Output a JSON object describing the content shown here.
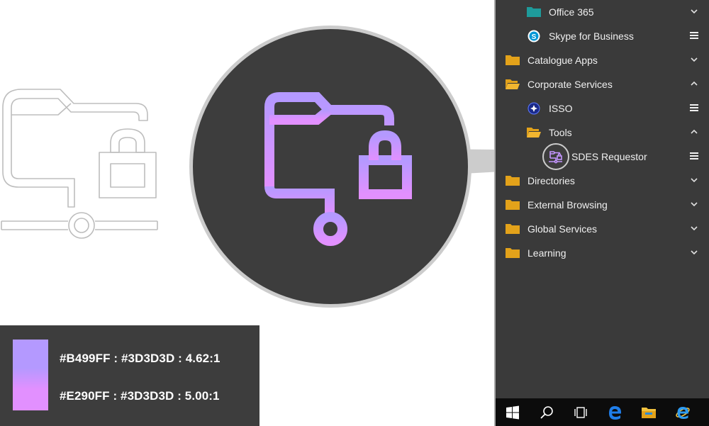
{
  "menu": {
    "items": [
      {
        "label": "Office 365",
        "level": 1,
        "icon": "folder-teal-icon",
        "action": "chevron-down-icon"
      },
      {
        "label": "Skype for Business",
        "level": 1,
        "icon": "skype-icon",
        "action": "hamburger-menu-icon"
      },
      {
        "label": "Catalogue Apps",
        "level": 0,
        "icon": "folder-icon",
        "action": "chevron-down-icon"
      },
      {
        "label": "Corporate Services",
        "level": 0,
        "icon": "folder-open-icon",
        "action": "chevron-up-icon"
      },
      {
        "label": "ISSO",
        "level": 1,
        "icon": "isso-icon",
        "action": "hamburger-menu-icon"
      },
      {
        "label": "Tools",
        "level": 1,
        "icon": "folder-open-icon",
        "action": "chevron-up-icon"
      },
      {
        "label": "SDES Requestor",
        "level": 2,
        "icon": "secure-network-folder-icon",
        "action": "hamburger-menu-icon"
      },
      {
        "label": "Directories",
        "level": 0,
        "icon": "folder-icon",
        "action": "chevron-down-icon"
      },
      {
        "label": "External Browsing",
        "level": 0,
        "icon": "folder-icon",
        "action": "chevron-down-icon"
      },
      {
        "label": "Global Services",
        "level": 0,
        "icon": "folder-icon",
        "action": "chevron-down-icon"
      },
      {
        "label": "Learning",
        "level": 0,
        "icon": "folder-icon",
        "action": "chevron-down-icon"
      }
    ]
  },
  "contrast": {
    "line1": "#B499FF : #3D3D3D : 4.62:1",
    "line2": "#E290FF : #3D3D3D : 5.00:1"
  },
  "colors": {
    "icon_gradient_top": "#B499FF",
    "icon_gradient_bottom": "#E290FF",
    "background": "#3D3D3D",
    "folder": "#E3A21A",
    "folder_teal": "#1E9B9B",
    "taskbar": "#0C0C0C"
  },
  "taskbar": {
    "buttons": [
      "windows-start-icon",
      "search-icon",
      "task-view-icon",
      "edge-browser-icon",
      "file-explorer-icon",
      "internet-explorer-icon"
    ]
  }
}
